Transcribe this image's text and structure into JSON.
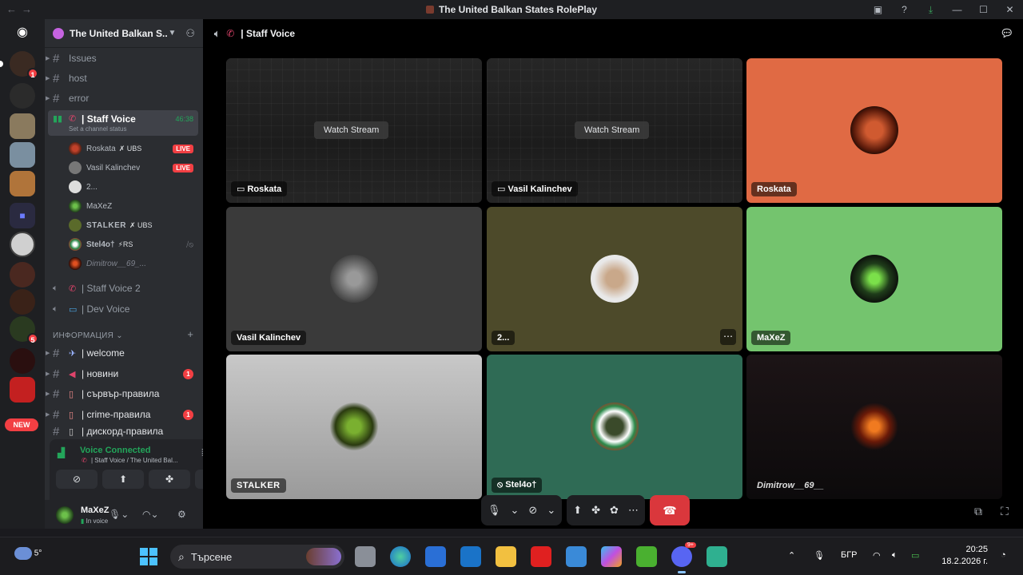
{
  "window": {
    "title": "The United Balkan States RolePlay"
  },
  "server": {
    "name": "The United Balkan S...",
    "guild_badges": [
      "1",
      "5"
    ],
    "new_label": "NEW"
  },
  "channels": {
    "top": [
      {
        "label": "Issues"
      },
      {
        "label": "host"
      },
      {
        "label": "error"
      }
    ],
    "active_voice": {
      "label": "| Staff Voice",
      "timer": "46:38",
      "status_placeholder": "Set a channel status"
    },
    "voice_users": [
      {
        "name": "Roskata",
        "tag": "UBS",
        "live": "LIVE"
      },
      {
        "name": "Vasil Kalinchev",
        "tag": "",
        "live": "LIVE"
      },
      {
        "name": "2...",
        "tag": "",
        "live": ""
      },
      {
        "name": "MaXeZ",
        "tag": "",
        "live": ""
      },
      {
        "name": "STALKER",
        "tag": "UBS",
        "live": ""
      },
      {
        "name": "Stel4o†",
        "tag": "⚡RS",
        "live": ""
      },
      {
        "name": "Dimitrow__69_...",
        "tag": "",
        "live": ""
      }
    ],
    "other_voice": [
      {
        "label": "| Staff Voice 2"
      },
      {
        "label": "| Dev Voice"
      }
    ],
    "category": "ИНФОРМАЦИЯ",
    "info": [
      {
        "label": "| welcome",
        "unread": ""
      },
      {
        "label": "| новини",
        "unread": "1"
      },
      {
        "label": "| сървър-правила",
        "unread": ""
      },
      {
        "label": "| crime-правила",
        "unread": "1"
      },
      {
        "label": "| дискорд-правила",
        "unread": ""
      }
    ]
  },
  "voice_panel": {
    "title": "Voice Connected",
    "subtitle": "| Staff Voice / The United Bal..."
  },
  "user": {
    "name": "MaXeZ",
    "status": "In voice"
  },
  "header": {
    "channel": "| Staff Voice"
  },
  "tiles": [
    {
      "name": "Roskata",
      "watch": "Watch Stream"
    },
    {
      "name": "Vasil Kalinchev",
      "watch": "Watch Stream"
    },
    {
      "name": "Roskata"
    },
    {
      "name": "Vasil Kalinchev"
    },
    {
      "name": "2..."
    },
    {
      "name": "MaXeZ"
    },
    {
      "name": "STALKER"
    },
    {
      "name": "Stel4o†"
    },
    {
      "name": "Dimitrow__69__"
    }
  ],
  "taskbar": {
    "temperature": "5°",
    "search_placeholder": "Търсене",
    "discord_badge": "9+",
    "language": "БГР",
    "time": "20:25",
    "date": "18.2.2026 г."
  },
  "colors": {
    "accent_green": "#23a55a",
    "live_red": "#f23f43",
    "hangup_red": "#da373c",
    "tile_orange": "#e06a44",
    "tile_green": "#74c46e",
    "tile_olive": "#4d4a2a",
    "tile_teal": "#2f6b55"
  }
}
